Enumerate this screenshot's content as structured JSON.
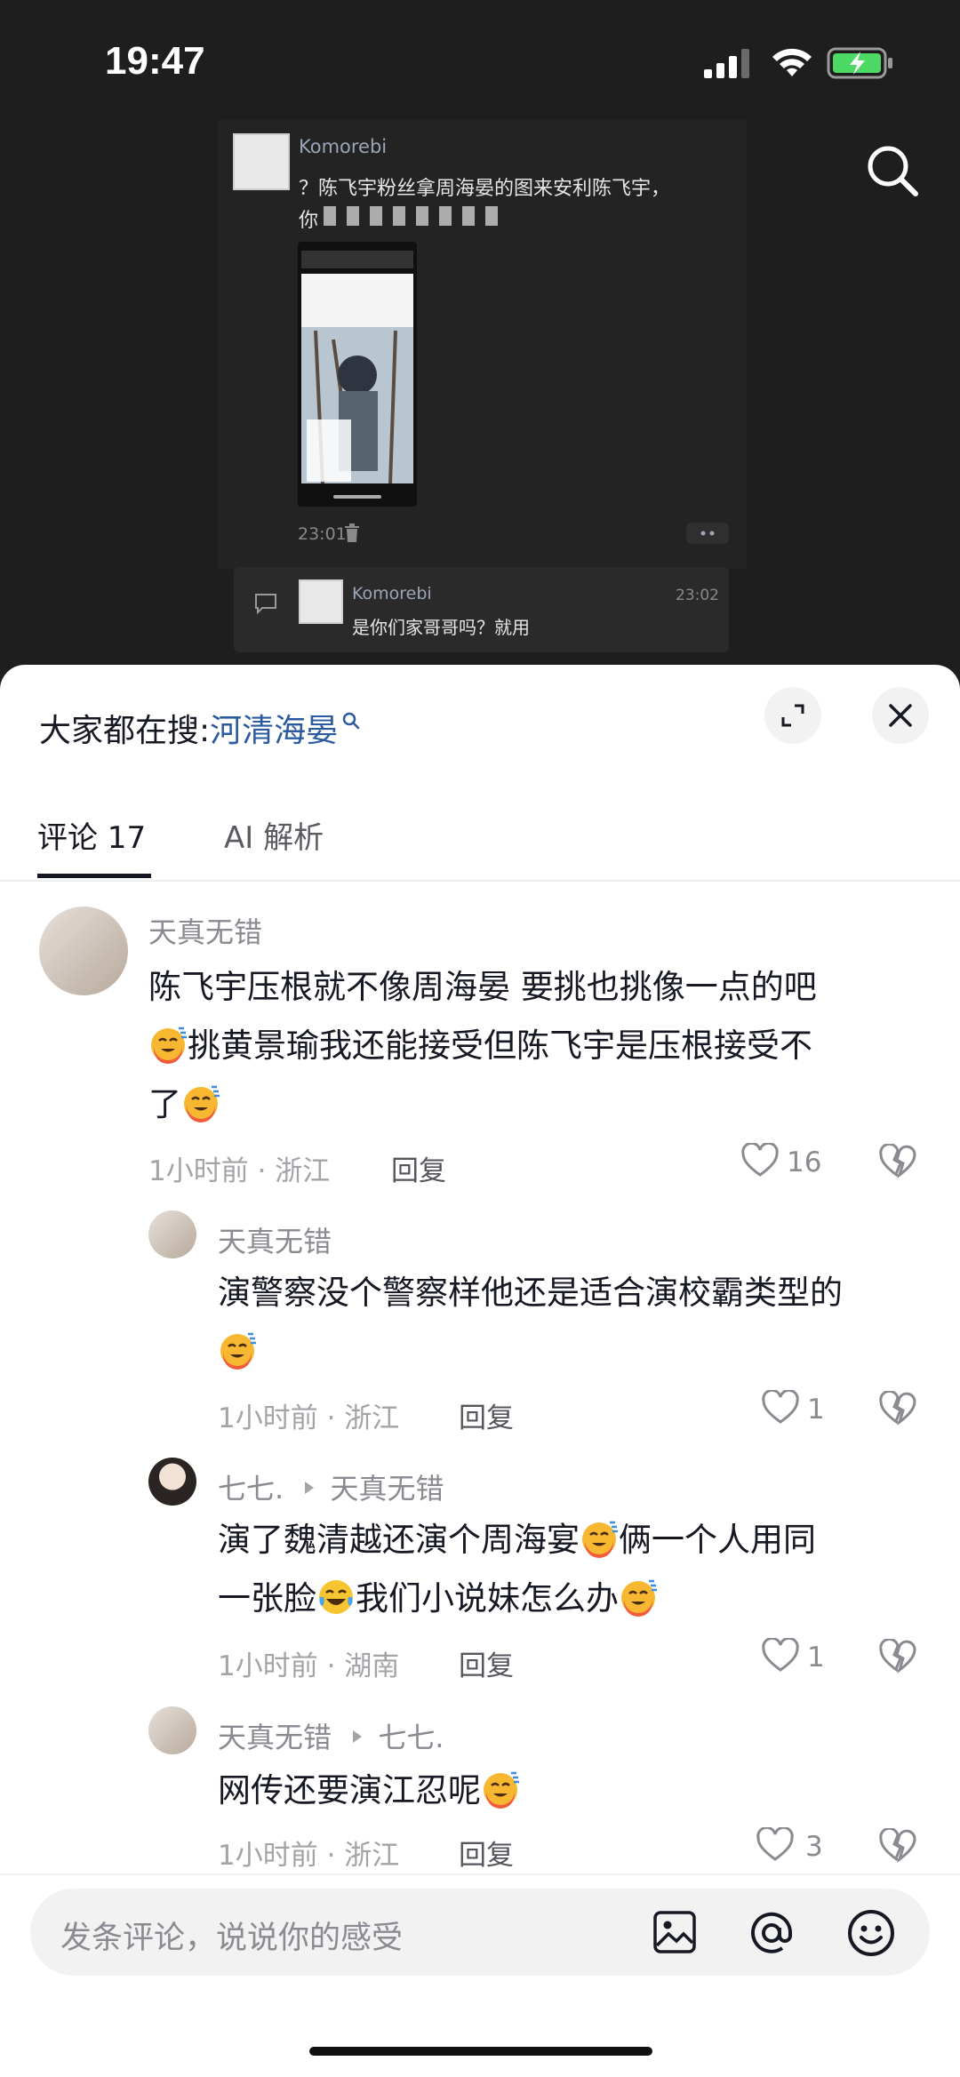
{
  "status_bar": {
    "time": "19:47"
  },
  "background_chat": {
    "sender": "Komorebi",
    "message_line1": "？陈飞宇粉丝拿周海晏的图来安利陈飞宇，",
    "message_line2": "你",
    "timestamp": "23:01",
    "reply_sender": "Komorebi",
    "reply_time": "23:02",
    "reply_text": "是你们家哥哥吗？就用"
  },
  "sheet": {
    "trending_prefix": "大家都在搜:",
    "trending_term": "河清海晏",
    "tabs": [
      {
        "label": "评论 17",
        "active": true
      },
      {
        "label": "AI 解析",
        "active": false
      }
    ]
  },
  "comments": [
    {
      "user": "天真无错",
      "line1": "陈飞宇压根就不像周海晏 要挑也挑像一点的吧",
      "line2": "挑黄景瑜我还能接受但陈飞宇是压根接受不",
      "line3": "了",
      "meta": "1小时前 · 浙江",
      "reply": "回复",
      "likes": "16"
    },
    {
      "user": "天真无错",
      "line1": "演警察没个警察样他还是适合演校霸类型的",
      "meta": "1小时前 · 浙江",
      "reply": "回复",
      "likes": "1"
    },
    {
      "user": "七七.",
      "reply_to": "天真无错",
      "line1a": "演了魏清越还演个周海宴",
      "line1b": "俩一个人用同",
      "line2a": "一张脸",
      "line2b": "我们小说妹怎么办",
      "meta": "1小时前 · 湖南",
      "reply": "回复",
      "likes": "1"
    },
    {
      "user": "天真无错",
      "reply_to": "七七.",
      "line1": "网传还要演江忍呢",
      "meta": "1小时前 · 浙江",
      "reply": "回复",
      "likes": "3"
    }
  ],
  "input": {
    "placeholder": "发条评论，说说你的感受"
  },
  "colors": {
    "accent_link": "#2b5b9e",
    "sheet_bg": "#ffffff",
    "dark_bg": "#1e1e1e"
  }
}
